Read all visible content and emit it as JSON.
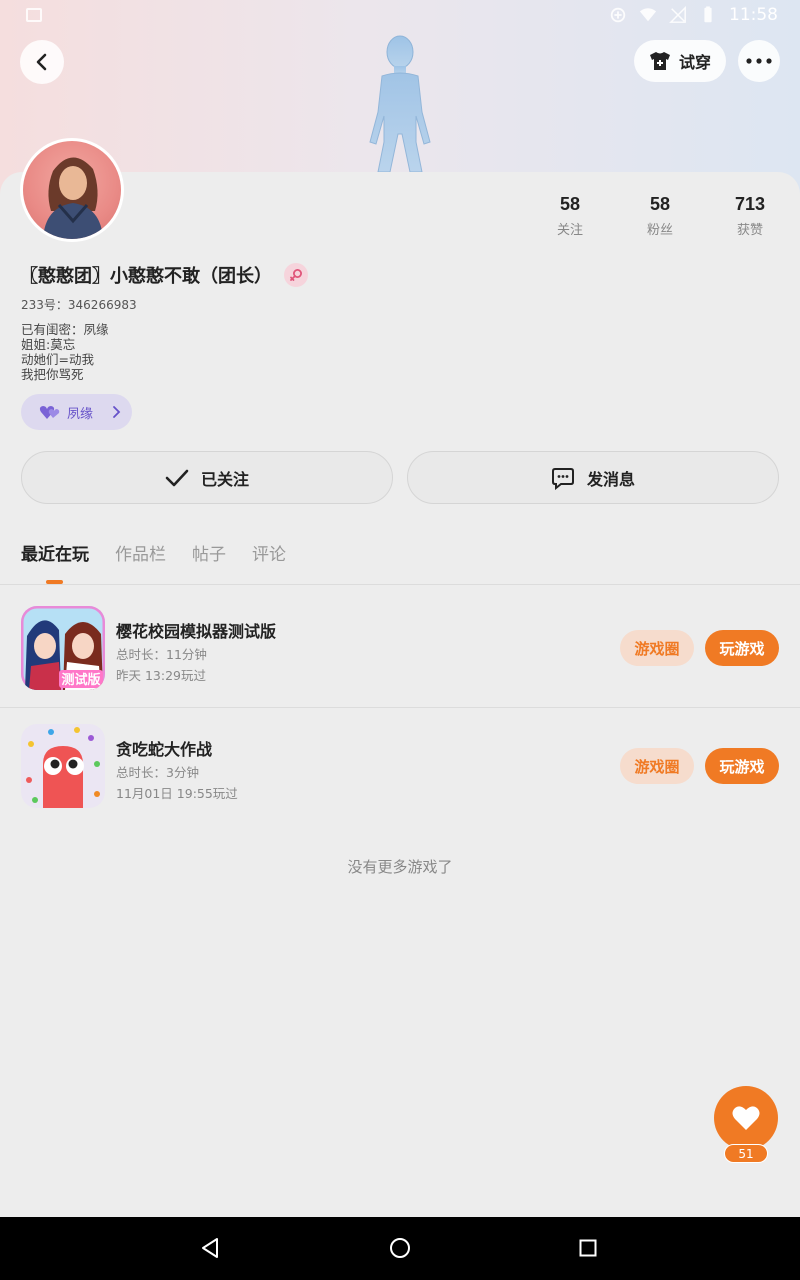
{
  "status_bar": {
    "time": "11:58"
  },
  "header": {
    "tryon_label": "试穿"
  },
  "profile": {
    "nickname": "〖憨憨团〗小憨憨不敢（团长）",
    "uid": "233号：346266983",
    "bio_lines": [
      "已有闺密：夙缘",
      "姐姐:莫忘",
      "动她们=动我",
      "我把你骂死"
    ],
    "bestie_tag": "夙缘"
  },
  "stats": [
    {
      "value": "58",
      "label": "关注"
    },
    {
      "value": "58",
      "label": "粉丝"
    },
    {
      "value": "713",
      "label": "获赞"
    }
  ],
  "actions": {
    "follow_label": "已关注",
    "message_label": "发消息"
  },
  "tabs": [
    {
      "label": "最近在玩",
      "active": true
    },
    {
      "label": "作品栏",
      "active": false
    },
    {
      "label": "帖子",
      "active": false
    },
    {
      "label": "评论",
      "active": false
    }
  ],
  "games": [
    {
      "title": "樱花校园模拟器测试版",
      "duration": "总时长：11分钟",
      "last_played": "昨天 13:29玩过",
      "icon_text": "测试版",
      "circle_label": "游戏圈",
      "play_label": "玩游戏"
    },
    {
      "title": "贪吃蛇大作战",
      "duration": "总时长：3分钟",
      "last_played": "11月01日 19:55玩过",
      "circle_label": "游戏圈",
      "play_label": "玩游戏"
    }
  ],
  "no_more_text": "没有更多游戏了",
  "fab": {
    "count": "51"
  },
  "colors": {
    "accent": "#f07a24",
    "accent_light": "#f6dccd",
    "bestie_bg": "#ddd9ef",
    "bestie_text": "#6652c9"
  }
}
